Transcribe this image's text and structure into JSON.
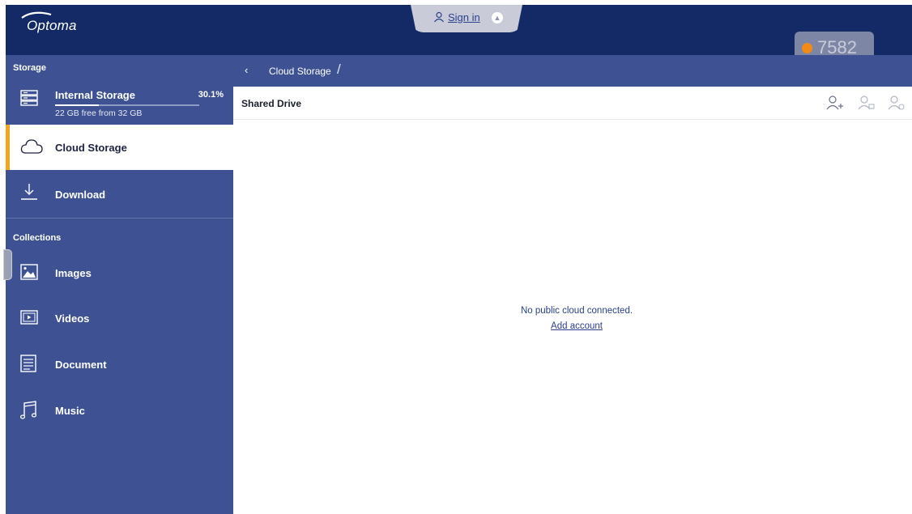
{
  "header": {
    "logo_text": "Optoma",
    "signin_label": "Sign in",
    "badge_number": "7582"
  },
  "sidebar": {
    "storage_title": "Storage",
    "internal_storage": {
      "label": "Internal Storage",
      "percent_text": "30.1%",
      "usage_fraction": 0.301,
      "free_text": "22 GB free from 32 GB"
    },
    "cloud_storage_label": "Cloud Storage",
    "download_label": "Download",
    "collections_title": "Collections",
    "collections": [
      {
        "label": "Images",
        "icon": "image-icon"
      },
      {
        "label": "Videos",
        "icon": "video-icon"
      },
      {
        "label": "Document",
        "icon": "document-icon"
      },
      {
        "label": "Music",
        "icon": "music-icon"
      }
    ]
  },
  "breadcrumb": {
    "current": "Cloud Storage",
    "separator": "/"
  },
  "content": {
    "section_title": "Shared Drive",
    "empty_message": "No public cloud connected.",
    "add_account_link": "Add account"
  },
  "colors": {
    "topbar": "#142a66",
    "sidebar": "#3d5193",
    "active_indicator": "#f2a71b",
    "badge_dot": "#f28a16"
  }
}
